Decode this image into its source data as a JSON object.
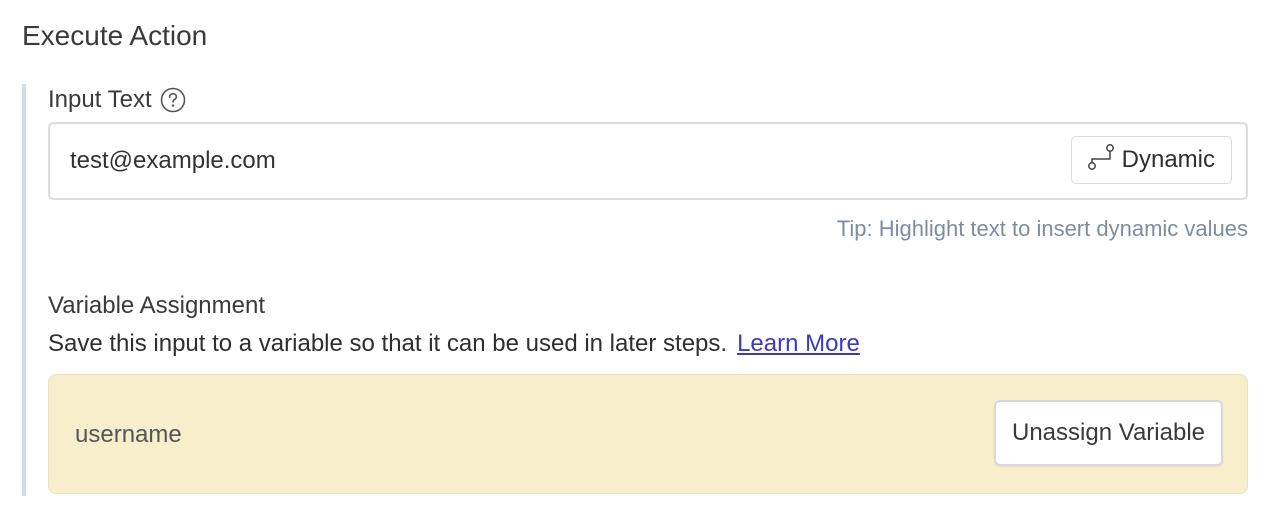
{
  "section": {
    "title": "Execute Action"
  },
  "input_text": {
    "label": "Input Text",
    "help_icon": "question-circle-icon",
    "value": "test@example.com",
    "dynamic_button": {
      "icon": "branch-connector-icon",
      "label": "Dynamic"
    },
    "tip": "Tip: Highlight text to insert dynamic values"
  },
  "variable_assignment": {
    "title": "Variable Assignment",
    "description": "Save this input to a variable so that it can be used in later steps.",
    "learn_more_label": "Learn More",
    "variable_name": "username",
    "unassign_label": "Unassign Variable"
  },
  "colors": {
    "panel_border": "#d6dce3",
    "tip_text": "#7d8da1",
    "link": "#3b3bb8",
    "variable_box_bg": "#f8eecb"
  }
}
